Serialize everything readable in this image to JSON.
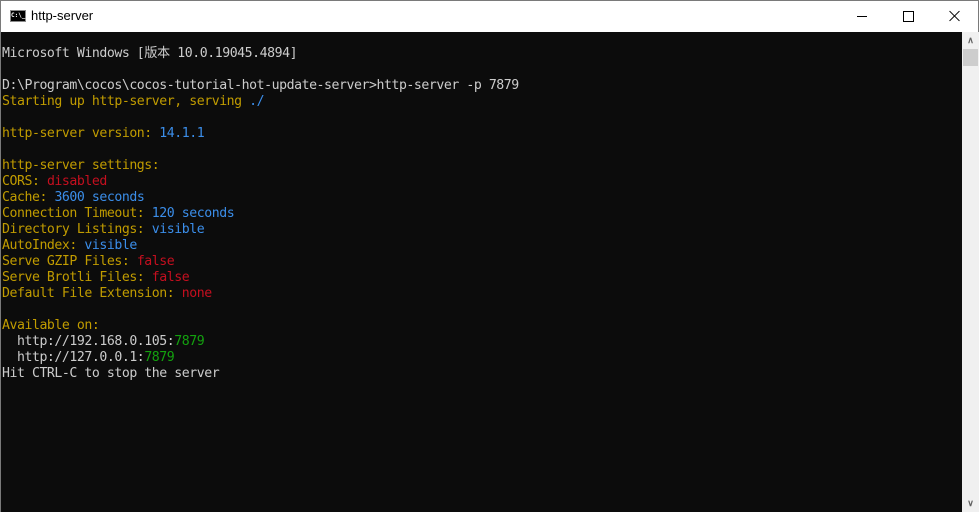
{
  "window": {
    "title": "http-server",
    "app_icon": "cmd-icon",
    "app_icon_text": "C:\\_",
    "controls": {
      "minimize": "minimize-icon",
      "maximize": "maximize-icon",
      "close": "close-icon"
    }
  },
  "colors": {
    "background": "#0c0c0c",
    "default_text": "#cccccc",
    "yellow": "#c19c00",
    "blue": "#3b8eea",
    "red": "#c50f1f",
    "green": "#13a10e"
  },
  "console": {
    "lines": [
      [
        {
          "text": "Microsoft Windows [版本 10.0.19045.4894]",
          "color": "white"
        }
      ],
      [],
      [
        {
          "text": "D:\\Program\\cocos\\cocos-tutorial-hot-update-server>http-server -p 7879",
          "color": "white"
        }
      ],
      [
        {
          "text": "Starting up http-server, serving ",
          "color": "yellow"
        },
        {
          "text": "./",
          "color": "blue"
        }
      ],
      [],
      [
        {
          "text": "http-server version: ",
          "color": "yellow"
        },
        {
          "text": "14.1.1",
          "color": "blue"
        }
      ],
      [],
      [
        {
          "text": "http-server settings: ",
          "color": "yellow"
        }
      ],
      [
        {
          "text": "CORS: ",
          "color": "yellow"
        },
        {
          "text": "disabled",
          "color": "red"
        }
      ],
      [
        {
          "text": "Cache: ",
          "color": "yellow"
        },
        {
          "text": "3600 seconds",
          "color": "blue"
        }
      ],
      [
        {
          "text": "Connection Timeout: ",
          "color": "yellow"
        },
        {
          "text": "120 seconds",
          "color": "blue"
        }
      ],
      [
        {
          "text": "Directory Listings: ",
          "color": "yellow"
        },
        {
          "text": "visible",
          "color": "blue"
        }
      ],
      [
        {
          "text": "AutoIndex: ",
          "color": "yellow"
        },
        {
          "text": "visible",
          "color": "blue"
        }
      ],
      [
        {
          "text": "Serve GZIP Files: ",
          "color": "yellow"
        },
        {
          "text": "false",
          "color": "red"
        }
      ],
      [
        {
          "text": "Serve Brotli Files: ",
          "color": "yellow"
        },
        {
          "text": "false",
          "color": "red"
        }
      ],
      [
        {
          "text": "Default File Extension: ",
          "color": "yellow"
        },
        {
          "text": "none",
          "color": "red"
        }
      ],
      [],
      [
        {
          "text": "Available on:",
          "color": "yellow"
        }
      ],
      [
        {
          "text": "  http://192.168.0.105:",
          "color": "white"
        },
        {
          "text": "7879",
          "color": "green"
        }
      ],
      [
        {
          "text": "  http://127.0.0.1:",
          "color": "white"
        },
        {
          "text": "7879",
          "color": "green"
        }
      ],
      [
        {
          "text": "Hit CTRL-C to stop the server",
          "color": "white"
        }
      ]
    ]
  },
  "scrollbar": {
    "up_icon": "chevron-up-icon",
    "down_icon": "chevron-down-icon"
  }
}
